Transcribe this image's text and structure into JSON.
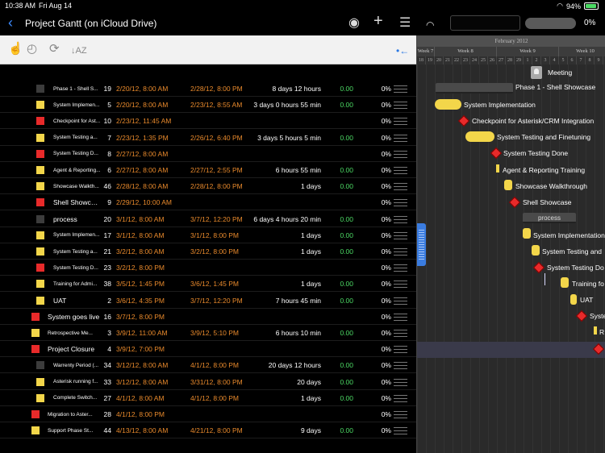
{
  "status_bar": {
    "time": "10:38 AM",
    "date": "Fri Aug 14",
    "battery": "94%",
    "battery_level": 0.94
  },
  "navbar": {
    "title": "Project Gantt (on iCloud Drive)",
    "progress_label": "0%",
    "progress": 0.0
  },
  "toolbar": {
    "icons": [
      "select-hand-icon",
      "time-icon",
      "time-refresh-icon",
      "sort-az-icon",
      "collapse-left-icon"
    ]
  },
  "colors": {
    "accent": "#2a78e4",
    "orange": "#e98a2c",
    "green": "#4cd964",
    "task_yellow": "#f3d64a",
    "milestone_red": "#e82a2a",
    "summary_gray": "#4a4a4a"
  },
  "rows": [
    {
      "name": "Phase 1 - Shell S...",
      "order": "19",
      "start": "2/20/12, 8:00 AM",
      "end": "2/28/12, 8:00 PM",
      "duration": "8 days 12 hours",
      "cost": "0.00",
      "percent": "0%",
      "color": "#3c3c3c"
    },
    {
      "name": "System Implemen...",
      "order": "5",
      "start": "2/20/12, 8:00 AM",
      "end": "2/23/12, 8:55 AM",
      "duration": "3 days 0 hours 55 min",
      "cost": "0.00",
      "percent": "0%",
      "color": "#f3d64a"
    },
    {
      "name": "Checkpoint for Ast...",
      "order": "10",
      "start": "2/23/12, 11:45 AM",
      "end": "",
      "duration": "",
      "cost": "",
      "percent": "0%",
      "color": "#e82a2a"
    },
    {
      "name": "System Testing a...",
      "order": "7",
      "start": "2/23/12, 1:35 PM",
      "end": "2/26/12, 6:40 PM",
      "duration": "3 days 5 hours 5 min",
      "cost": "0.00",
      "percent": "0%",
      "color": "#f3d64a"
    },
    {
      "name": "System Testing D...",
      "order": "8",
      "start": "2/27/12, 8:00 AM",
      "end": "",
      "duration": "",
      "cost": "",
      "percent": "0%",
      "color": "#e82a2a"
    },
    {
      "name": "Agent & Reporting...",
      "order": "6",
      "start": "2/27/12, 8:00 AM",
      "end": "2/27/12, 2:55 PM",
      "duration": "6 hours 55 min",
      "cost": "0.00",
      "percent": "0%",
      "color": "#f3d64a"
    },
    {
      "name": "Showcase Walkth...",
      "order": "46",
      "start": "2/28/12, 8:00 AM",
      "end": "2/28/12, 8:00 PM",
      "duration": "1 days",
      "cost": "0.00",
      "percent": "0%",
      "color": "#f3d64a"
    },
    {
      "name": "Shell Showcase",
      "order": "9",
      "start": "2/29/12, 10:00 AM",
      "end": "",
      "duration": "",
      "cost": "",
      "percent": "0%",
      "color": "#e82a2a",
      "big": true
    },
    {
      "name": "process",
      "order": "20",
      "start": "3/1/12, 8:00 AM",
      "end": "3/7/12, 12:20 PM",
      "duration": "6 days 4 hours 20 min",
      "cost": "0.00",
      "percent": "0%",
      "color": "#3c3c3c",
      "big": true
    },
    {
      "name": "System Implemen...",
      "order": "17",
      "start": "3/1/12, 8:00 AM",
      "end": "3/1/12, 8:00 PM",
      "duration": "1 days",
      "cost": "0.00",
      "percent": "0%",
      "color": "#f3d64a"
    },
    {
      "name": "System Testing a...",
      "order": "21",
      "start": "3/2/12, 8:00 AM",
      "end": "3/2/12, 8:00 PM",
      "duration": "1 days",
      "cost": "0.00",
      "percent": "0%",
      "color": "#f3d64a"
    },
    {
      "name": "System Testing D...",
      "order": "23",
      "start": "3/2/12, 8:00 PM",
      "end": "",
      "duration": "",
      "cost": "",
      "percent": "0%",
      "color": "#e82a2a"
    },
    {
      "name": "Training for Admi...",
      "order": "38",
      "start": "3/5/12, 1:45 PM",
      "end": "3/6/12, 1:45 PM",
      "duration": "1 days",
      "cost": "0.00",
      "percent": "0%",
      "color": "#f3d64a"
    },
    {
      "name": "UAT",
      "order": "2",
      "start": "3/6/12, 4:35 PM",
      "end": "3/7/12, 12:20 PM",
      "duration": "7 hours 45 min",
      "cost": "0.00",
      "percent": "0%",
      "color": "#f3d64a",
      "big": true
    },
    {
      "name": "System goes live",
      "order": "16",
      "start": "3/7/12, 8:00 PM",
      "end": "",
      "duration": "",
      "cost": "",
      "percent": "0%",
      "color": "#e82a2a",
      "big": true,
      "outdent": true
    },
    {
      "name": "Retrospective Me...",
      "order": "3",
      "start": "3/9/12, 11:00 AM",
      "end": "3/9/12, 5:10 PM",
      "duration": "6 hours 10 min",
      "cost": "0.00",
      "percent": "0%",
      "color": "#f3d64a",
      "outdent": true
    },
    {
      "name": "Project Closure",
      "order": "4",
      "start": "3/9/12, 7:00 PM",
      "end": "",
      "duration": "",
      "cost": "",
      "percent": "0%",
      "color": "#e82a2a",
      "big": true,
      "outdent": true
    },
    {
      "name": "Warrenty Period (...",
      "order": "34",
      "start": "3/12/12, 8:00 AM",
      "end": "4/1/12, 8:00 PM",
      "duration": "20 days 12 hours",
      "cost": "0.00",
      "percent": "0%",
      "color": "#3c3c3c"
    },
    {
      "name": "Asterisk running f...",
      "order": "33",
      "start": "3/12/12, 8:00 AM",
      "end": "3/31/12, 8:00 PM",
      "duration": "20 days",
      "cost": "0.00",
      "percent": "0%",
      "color": "#f3d64a"
    },
    {
      "name": "Complete Switch...",
      "order": "27",
      "start": "4/1/12, 8:00 AM",
      "end": "4/1/12, 8:00 PM",
      "duration": "1 days",
      "cost": "0.00",
      "percent": "0%",
      "color": "#f3d64a"
    },
    {
      "name": "Migration to Aster...",
      "order": "28",
      "start": "4/1/12, 8:00 PM",
      "end": "",
      "duration": "",
      "cost": "",
      "percent": "0%",
      "color": "#e82a2a",
      "outdent": true
    },
    {
      "name": "Support Phase St...",
      "order": "44",
      "start": "4/13/12, 8:00 AM",
      "end": "4/21/12, 8:00 PM",
      "duration": "9 days",
      "cost": "0.00",
      "percent": "0%",
      "color": "#f3d64a",
      "outdent": true
    }
  ],
  "gantt": {
    "month": "February 2012",
    "weeks": [
      "Week 7",
      "Week 8",
      "Week 9",
      "Week 10"
    ],
    "days": [
      "18",
      "19",
      "20",
      "21",
      "22",
      "23",
      "24",
      "25",
      "26",
      "27",
      "28",
      "29",
      "1",
      "2",
      "3",
      "4",
      "5",
      "6",
      "7",
      "8",
      "9",
      "10"
    ],
    "labels": {
      "meeting": "Meeting",
      "phase1": "Phase 1 - Shell Showcase",
      "sys_impl": "System Implementation",
      "checkpoint": "Checkpoint for Asterisk/CRM Integration",
      "sys_test": "System Testing and Finetuning",
      "sys_test_done": "System Testing Done",
      "agent": "Agent & Reporting Training",
      "showcase": "Showcase Walkthrough",
      "shell": "Shell Showcase",
      "process": "process",
      "sys_impl2": "System Implementation",
      "sys_test2": "System Testing and",
      "sys_test_done2": "System Testing Do",
      "training": "Training fo",
      "uat": "UAT",
      "live": "Syste",
      "retro": "R"
    }
  }
}
